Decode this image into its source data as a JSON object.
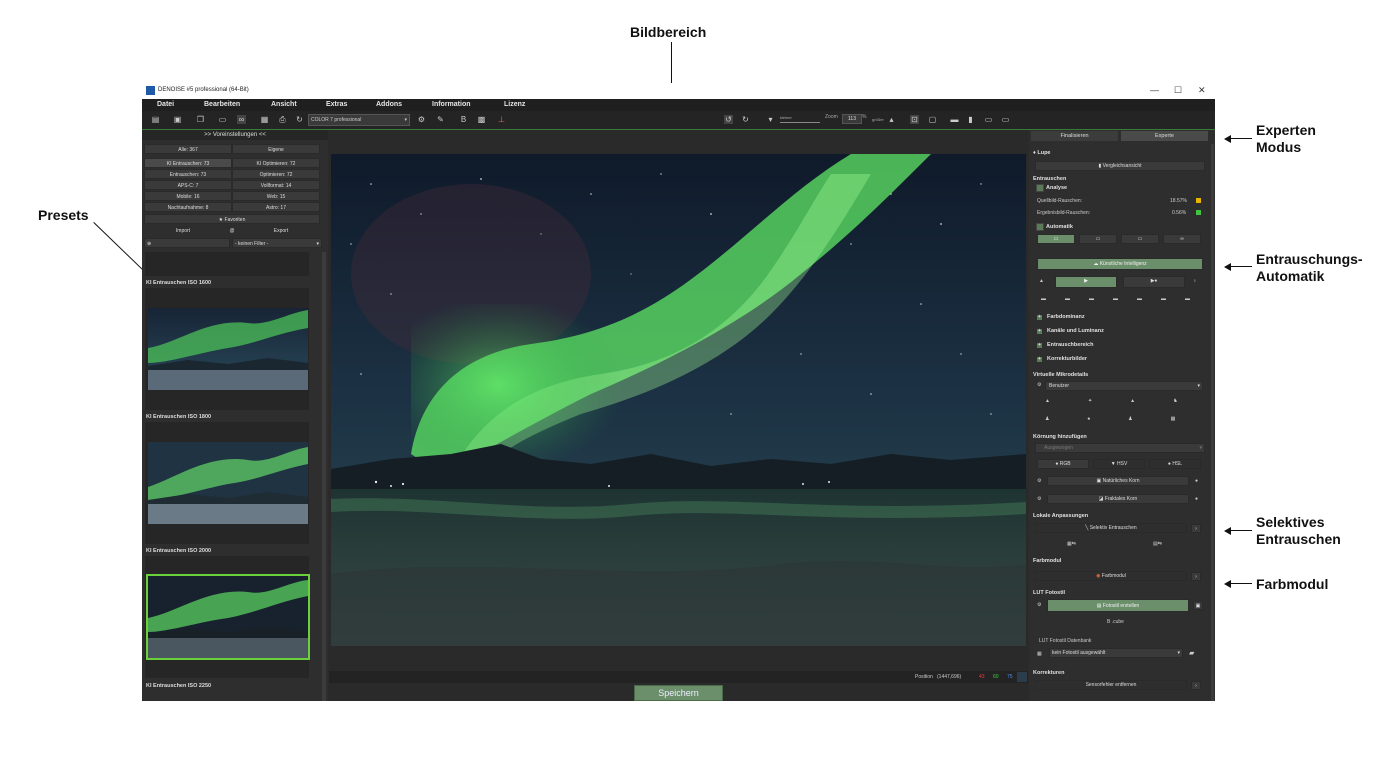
{
  "annotations": {
    "image_area": "Bildbereich",
    "expert_mode_1": "Experten",
    "expert_mode_2": "Modus",
    "presets": "Presets",
    "auto_1": "Entrauschungs-",
    "auto_2": "Automatik",
    "selective_1": "Selektives",
    "selective_2": "Entrauschen",
    "color_module": "Farbmodul"
  },
  "window": {
    "title": "DENOISE #5 professional (64-Bit)",
    "controls": [
      "—",
      "☐",
      "✕"
    ]
  },
  "menu": [
    "Datei",
    "Bearbeiten",
    "Ansicht",
    "Extras",
    "Addons",
    "Information",
    "Lizenz"
  ],
  "toolbar": {
    "color_profile": "COLOR 7 professional",
    "zoom_label": "Zoom",
    "zoom_value": "113",
    "zoom_unit": "%",
    "smaller": "kleiner",
    "larger": "größer"
  },
  "left_panel": {
    "header": ">> Voreinstellungen <<",
    "all": "Alle: 367",
    "own": "Eigene",
    "categories": [
      "KI Entrauschen: 73",
      "KI Optimieren: 72",
      "Entrauschen: 73",
      "Optimieren: 72",
      "APS-C: 7",
      "Vollformat: 14",
      "Mobile: 16",
      "Web: 15",
      "Nachtaufnahme: 8",
      "Astro: 17"
    ],
    "favorites": "★ Favoriten",
    "import": "Import",
    "at": "@",
    "export": "Export",
    "filter": "- keinen Filter -",
    "presets": [
      {
        "label": "KI Entrauschen ISO 1600"
      },
      {
        "label": "KI Entrauschen ISO 1800"
      },
      {
        "label": "KI Entrauschen ISO 2000"
      },
      {
        "label": "KI Entrauschen ISO 2250"
      }
    ]
  },
  "center": {
    "position_label": "Position",
    "position_value": "(1447,696)",
    "r": "43",
    "g": "60",
    "b": "75",
    "save": "Speichern"
  },
  "right_panel": {
    "tab_finalize": "Finalisieren",
    "tab_expert": "Experte",
    "loupe": "Lupe",
    "compare_view": "Vergleichsansicht",
    "denoise": "Entrauschen",
    "analysis": "Analyse",
    "source_noise_label": "Quellbild-Rauschen:",
    "source_noise_value": "18.57%",
    "result_noise_label": "Ergebnisbild-Rauschen:",
    "result_noise_value": "0.56%",
    "automatic": "Automatik",
    "ai": "Künstliche Intelligenz",
    "collapsibles": [
      "Farbdominanz",
      "Kanäle und Luminanz",
      "Entrauschbereich",
      "Korrekturbilder"
    ],
    "virtual_micro": "Virtuelle Mikrodetails",
    "user": "Benutzer",
    "grain_add": "Körnung hinzufügen",
    "grain_select": "Ausgewogen",
    "rgb": "RGB",
    "hsv": "HSV",
    "hsl": "HSL",
    "natural_grain": "Natürliches Korn",
    "fractal_grain": "Fraktales Korn",
    "local_adjust": "Lokale Anpassungen",
    "selective_denoise": "Selektiv Entrauschen",
    "color_module_section": "Farbmodul",
    "color_module_btn": "Farbmodul",
    "lut": "LUT Fotostil",
    "create_style": "Fotostil erstellen",
    "cube": ".cube",
    "lut_db": "LUT Fotostil Datenbank",
    "no_style": "kein Fotostil ausgewählt",
    "corrections": "Korrekturen",
    "remove_sensor": "Sensorfehler entfernen"
  },
  "colors": {
    "accent_green": "#6bd13a",
    "button_green": "#6b8f6b",
    "noise_source": "#e8b400",
    "noise_result": "#3ec43e"
  }
}
